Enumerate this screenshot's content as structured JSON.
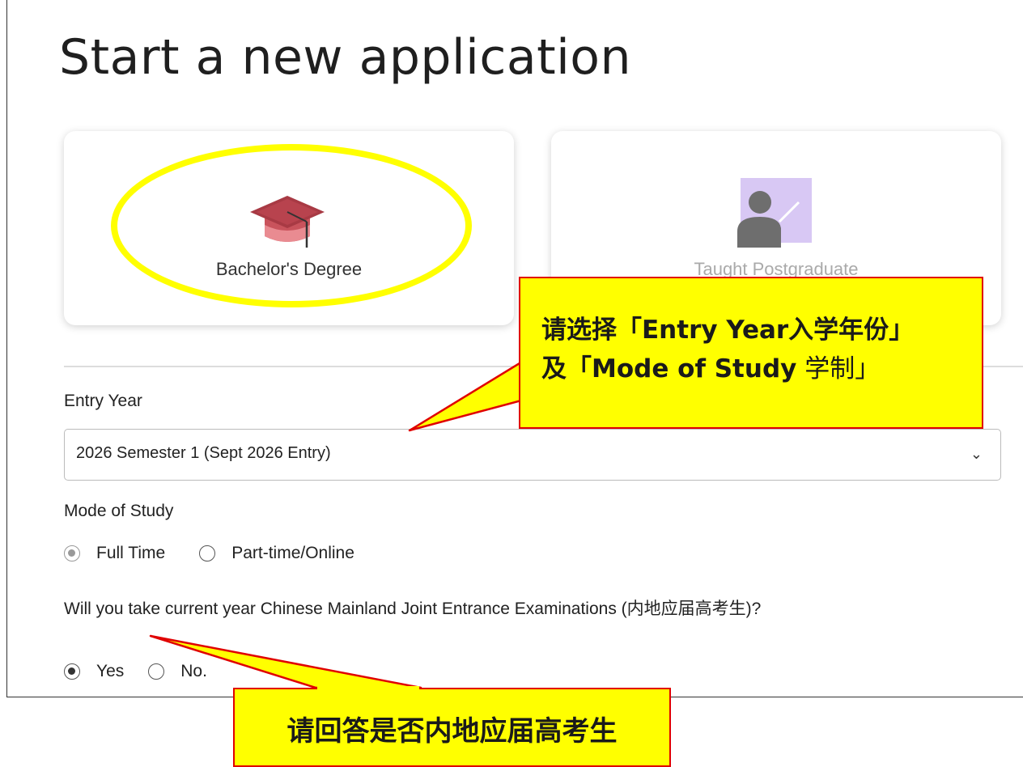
{
  "page": {
    "title": "Start a new application"
  },
  "programme_cards": [
    {
      "label": "Bachelor's Degree",
      "icon": "graduation-cap-icon",
      "selected": true
    },
    {
      "label": "Taught Postgraduate",
      "icon": "teacher-icon",
      "selected": false
    }
  ],
  "entry_year": {
    "label": "Entry Year",
    "value": "2026 Semester 1 (Sept 2026 Entry)"
  },
  "mode_of_study": {
    "label": "Mode of Study",
    "options": [
      {
        "label": "Full Time",
        "checked": true
      },
      {
        "label": "Part-time/Online",
        "checked": false
      }
    ]
  },
  "exam_question": {
    "label": "Will you take current year Chinese Mainland Joint Entrance Examinations (内地应届高考生)?",
    "options": [
      {
        "label": "Yes",
        "checked": true
      },
      {
        "label": "No.",
        "checked": false
      }
    ]
  },
  "annotations": {
    "callout_1_line_1_prefix": "请选择「",
    "callout_1_line_1_bold": "Entry Year入学年份",
    "callout_1_line_1_suffix": "」",
    "callout_1_line_2_prefix": "及「",
    "callout_1_line_2_bold": "Mode of Study",
    "callout_1_line_2_suffix": " 学制」",
    "callout_2": "请回答是否内地应届高考生"
  },
  "colors": {
    "highlight": "#ffff00",
    "callout_border": "#e00000",
    "cap_color": "#d9676f",
    "teacher_bg": "#d8c8f4"
  }
}
